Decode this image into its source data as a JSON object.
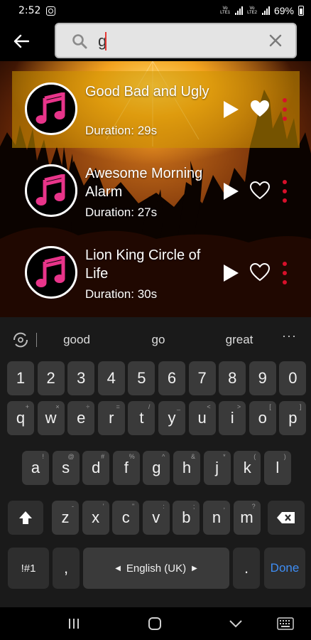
{
  "status": {
    "time": "2:52",
    "lte1": "VoLTE LTE1",
    "lte2": "VoLTE LTE2",
    "battery": "69%"
  },
  "search": {
    "value": "g"
  },
  "songs": [
    {
      "title": "Good Bad and Ugly",
      "duration": "Duration: 29s",
      "favorite": true
    },
    {
      "title": "Awesome Morning Alarm",
      "duration": "Duration: 27s",
      "favorite": false
    },
    {
      "title": "Lion King Circle of Life",
      "duration": "Duration: 30s",
      "favorite": false
    }
  ],
  "keyboard": {
    "suggestions": [
      "good",
      "go",
      "great"
    ],
    "more": "···",
    "numbers": [
      "1",
      "2",
      "3",
      "4",
      "5",
      "6",
      "7",
      "8",
      "9",
      "0"
    ],
    "row1": [
      "q",
      "w",
      "e",
      "r",
      "t",
      "y",
      "u",
      "i",
      "o",
      "p"
    ],
    "row1_hints": [
      "+",
      "×",
      "÷",
      "=",
      "/",
      "_",
      "<",
      ">",
      "[",
      "]"
    ],
    "row2": [
      "a",
      "s",
      "d",
      "f",
      "g",
      "h",
      "j",
      "k",
      "l"
    ],
    "row2_hints": [
      "!",
      "@",
      "#",
      "%",
      "^",
      "&",
      "*",
      "(",
      ")"
    ],
    "row3": [
      "z",
      "x",
      "c",
      "v",
      "b",
      "n",
      "m"
    ],
    "row3_hints": [
      "-",
      "'",
      "\"",
      ":",
      ";",
      ",",
      "?"
    ],
    "symbols_label": "!#1",
    "comma_label": ",",
    "space_label": "English (UK)",
    "period_label": ".",
    "done_label": "Done"
  },
  "colors": {
    "accent_pink": "#e8348a",
    "more_red": "#d8102a",
    "done_blue": "#3f8ef5"
  }
}
